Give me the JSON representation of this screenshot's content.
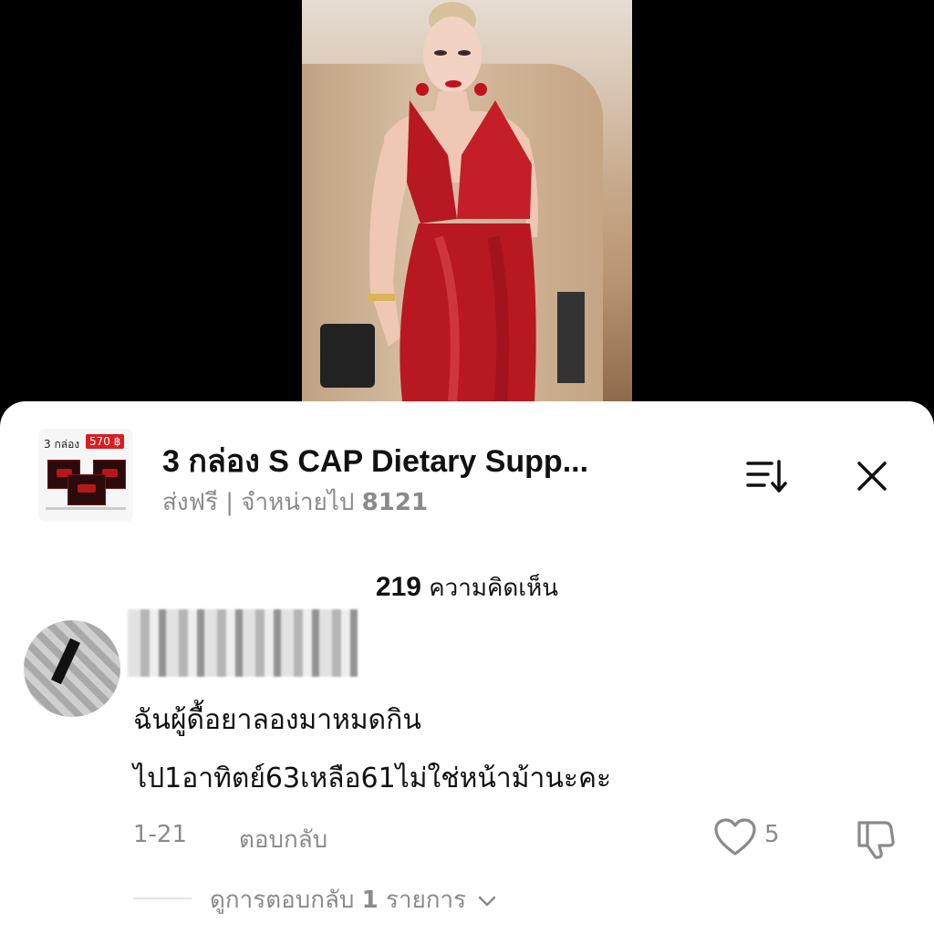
{
  "product": {
    "thumbnail": {
      "quantity_label": "3 กล่อง",
      "price_label": "570 ฿"
    },
    "title": "3 กล่อง S CAP Dietary Supp...",
    "shipping": "ส่งฟรี",
    "separator": "|",
    "sold_label": "จำหน่ายไป",
    "sold_count": "8121"
  },
  "icons": {
    "sort": "sort-icon",
    "close": "close-icon",
    "heart": "heart-icon",
    "dislike": "thumbs-down-icon",
    "chevron": "chevron-down-icon"
  },
  "comments_header": {
    "count": "219",
    "label": "ความคิดเห็น"
  },
  "comment": {
    "username": "",
    "text_line1": "ฉันผู้ดื้อยาลองมาหมดกิน",
    "text_line2": "ไป1อาทิตย์63เหลือ61ไม่ใช่หน้าม้านะคะ",
    "date": "1-21",
    "reply_label": "ตอบกลับ",
    "like_count": "5",
    "view_replies_prefix": "ดูการตอบกลับ",
    "view_replies_count": "1",
    "view_replies_suffix": "รายการ"
  },
  "colors": {
    "price_badge": "#d81e22",
    "secondary_text": "#8a8a8a",
    "primary_text": "#111111",
    "dress": "#b81822"
  }
}
